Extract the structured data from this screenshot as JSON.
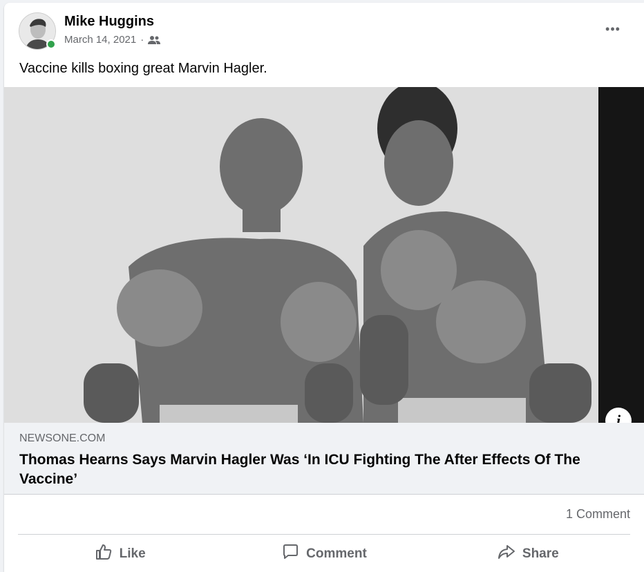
{
  "post": {
    "author": "Mike Huggins",
    "date": "March 14, 2021",
    "separator": "·",
    "audience_icon": "friends-icon",
    "text": "Vaccine kills boxing great Marvin Hagler.",
    "more_icon": "more-options-icon",
    "more_label": "•••"
  },
  "link": {
    "domain": "NEWSONE.COM",
    "title": "Thomas Hearns Says Marvin Hagler Was ‘In ICU Fighting The After Effects Of The Vaccine’",
    "info_label": "i"
  },
  "footer": {
    "comments": "1 Comment",
    "actions": [
      {
        "label": "Like",
        "icon": "thumbs-up-icon"
      },
      {
        "label": "Comment",
        "icon": "comment-icon"
      },
      {
        "label": "Share",
        "icon": "share-icon"
      }
    ]
  },
  "colors": {
    "online": "#31a24c",
    "secondary_text": "#65676b",
    "link_bg": "#f0f2f5"
  }
}
